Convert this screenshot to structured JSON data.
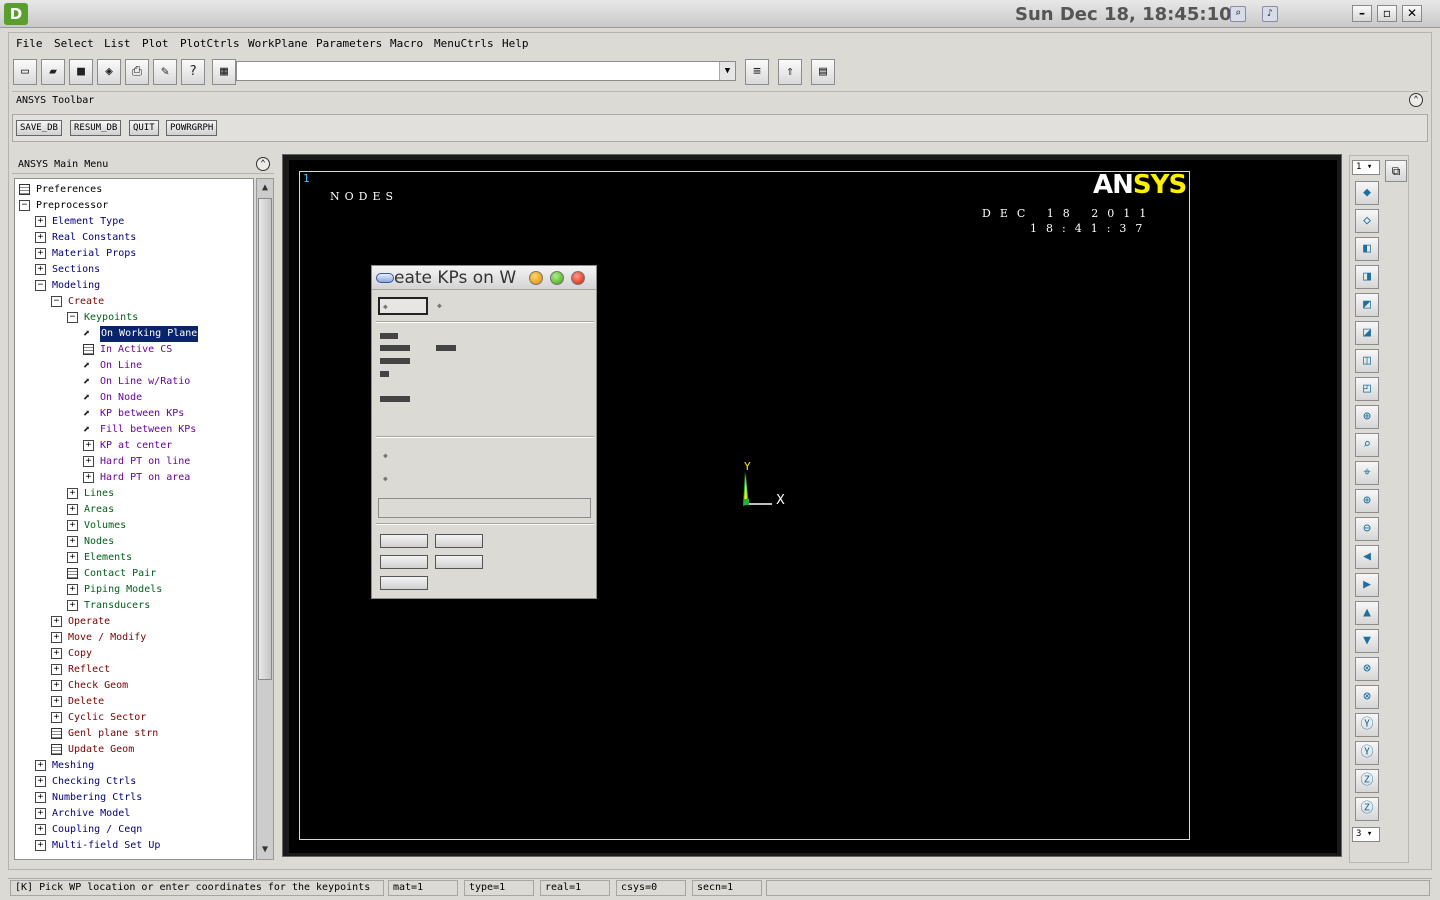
{
  "system": {
    "clock": "Sun Dec 18, 18:45:10",
    "logo": "D"
  },
  "menubar": [
    {
      "label": "File",
      "key": "F"
    },
    {
      "label": "Select",
      "key": "S"
    },
    {
      "label": "List",
      "key": "L"
    },
    {
      "label": "Plot",
      "key": "P"
    },
    {
      "label": "PlotCtrls",
      "key": "C"
    },
    {
      "label": "WorkPlane",
      "key": "W"
    },
    {
      "label": "Parameters",
      "key": "a"
    },
    {
      "label": "Macro",
      "key": "M"
    },
    {
      "label": "MenuCtrls",
      "key": "n"
    },
    {
      "label": "Help",
      "key": "H"
    }
  ],
  "toolbar": {
    "command_input_value": ""
  },
  "ansys_toolbar": {
    "title": "ANSYS Toolbar",
    "buttons": [
      "SAVE_DB",
      "RESUM_DB",
      "QUIT",
      "POWRGRPH"
    ]
  },
  "main_menu": {
    "title": "ANSYS Main Menu",
    "items": [
      {
        "label": "Preferences",
        "level": 0,
        "icon": "dialog"
      },
      {
        "label": "Preprocessor",
        "level": 0,
        "icon": "minus"
      },
      {
        "label": "Element Type",
        "level": 1,
        "icon": "plus"
      },
      {
        "label": "Real Constants",
        "level": 1,
        "icon": "plus"
      },
      {
        "label": "Material Props",
        "level": 1,
        "icon": "plus"
      },
      {
        "label": "Sections",
        "level": 1,
        "icon": "plus"
      },
      {
        "label": "Modeling",
        "level": 1,
        "icon": "minus"
      },
      {
        "label": "Create",
        "level": 2,
        "icon": "minus"
      },
      {
        "label": "Keypoints",
        "level": 3,
        "icon": "minus"
      },
      {
        "label": "On Working Plane",
        "level": 4,
        "icon": "pick",
        "selected": true
      },
      {
        "label": "In Active CS",
        "level": 4,
        "icon": "dialog"
      },
      {
        "label": "On Line",
        "level": 4,
        "icon": "pick"
      },
      {
        "label": "On Line w/Ratio",
        "level": 4,
        "icon": "pick"
      },
      {
        "label": "On Node",
        "level": 4,
        "icon": "pick"
      },
      {
        "label": "KP between KPs",
        "level": 4,
        "icon": "pick"
      },
      {
        "label": "Fill between KPs",
        "level": 4,
        "icon": "pick"
      },
      {
        "label": "KP at center",
        "level": 4,
        "icon": "plus"
      },
      {
        "label": "Hard PT on line",
        "level": 4,
        "icon": "plus"
      },
      {
        "label": "Hard PT on area",
        "level": 4,
        "icon": "plus"
      },
      {
        "label": "Lines",
        "level": 3,
        "icon": "plus"
      },
      {
        "label": "Areas",
        "level": 3,
        "icon": "plus"
      },
      {
        "label": "Volumes",
        "level": 3,
        "icon": "plus"
      },
      {
        "label": "Nodes",
        "level": 3,
        "icon": "plus"
      },
      {
        "label": "Elements",
        "level": 3,
        "icon": "plus"
      },
      {
        "label": "Contact Pair",
        "level": 3,
        "icon": "dialog"
      },
      {
        "label": "Piping Models",
        "level": 3,
        "icon": "plus"
      },
      {
        "label": "Transducers",
        "level": 3,
        "icon": "plus"
      },
      {
        "label": "Operate",
        "level": 2,
        "icon": "plus"
      },
      {
        "label": "Move / Modify",
        "level": 2,
        "icon": "plus"
      },
      {
        "label": "Copy",
        "level": 2,
        "icon": "plus"
      },
      {
        "label": "Reflect",
        "level": 2,
        "icon": "plus"
      },
      {
        "label": "Check Geom",
        "level": 2,
        "icon": "plus"
      },
      {
        "label": "Delete",
        "level": 2,
        "icon": "plus"
      },
      {
        "label": "Cyclic Sector",
        "level": 2,
        "icon": "plus"
      },
      {
        "label": "Genl plane strn",
        "level": 2,
        "icon": "dialog"
      },
      {
        "label": "Update Geom",
        "level": 2,
        "icon": "dialog"
      },
      {
        "label": "Meshing",
        "level": 1,
        "icon": "plus"
      },
      {
        "label": "Checking Ctrls",
        "level": 1,
        "icon": "plus"
      },
      {
        "label": "Numbering Ctrls",
        "level": 1,
        "icon": "plus"
      },
      {
        "label": "Archive Model",
        "level": 1,
        "icon": "plus"
      },
      {
        "label": "Coupling / Ceqn",
        "level": 1,
        "icon": "plus"
      },
      {
        "label": "Multi-field Set Up",
        "level": 1,
        "icon": "plus"
      }
    ]
  },
  "graphics": {
    "window_number": "1",
    "plot_title": "NODES",
    "date": "DEC 18 2011",
    "time": "18:41:37",
    "logo_an": "AN",
    "logo_sys": "SYS",
    "axis_x": "X",
    "axis_y": "Y"
  },
  "right_panel": {
    "window_select": "1",
    "zoom_select": "3",
    "buttons": [
      "iso-view-icon",
      "oblique-view-icon",
      "front-view-icon",
      "right-view-icon",
      "top-view-icon",
      "back-view-icon",
      "left-view-icon",
      "bottom-view-icon",
      "zoom-icon",
      "box-zoom-icon",
      "win-zoom-icon",
      "zoom-in-icon",
      "zoom-out-icon",
      "pan-left-icon",
      "pan-right-icon",
      "pan-up-icon",
      "pan-down-icon",
      "rotate-x-neg-icon",
      "rotate-x-pos-icon",
      "rotate-y-neg-icon",
      "rotate-y-pos-icon",
      "rotate-z-neg-icon",
      "rotate-z-pos-icon"
    ]
  },
  "dialog": {
    "title": "eate KPs on W"
  },
  "status": {
    "prompt": "[K]  Pick WP location or enter coordinates for the keypoints",
    "mat": "mat=1",
    "type": "type=1",
    "real": "real=1",
    "csys": "csys=0",
    "secn": "secn=1"
  }
}
